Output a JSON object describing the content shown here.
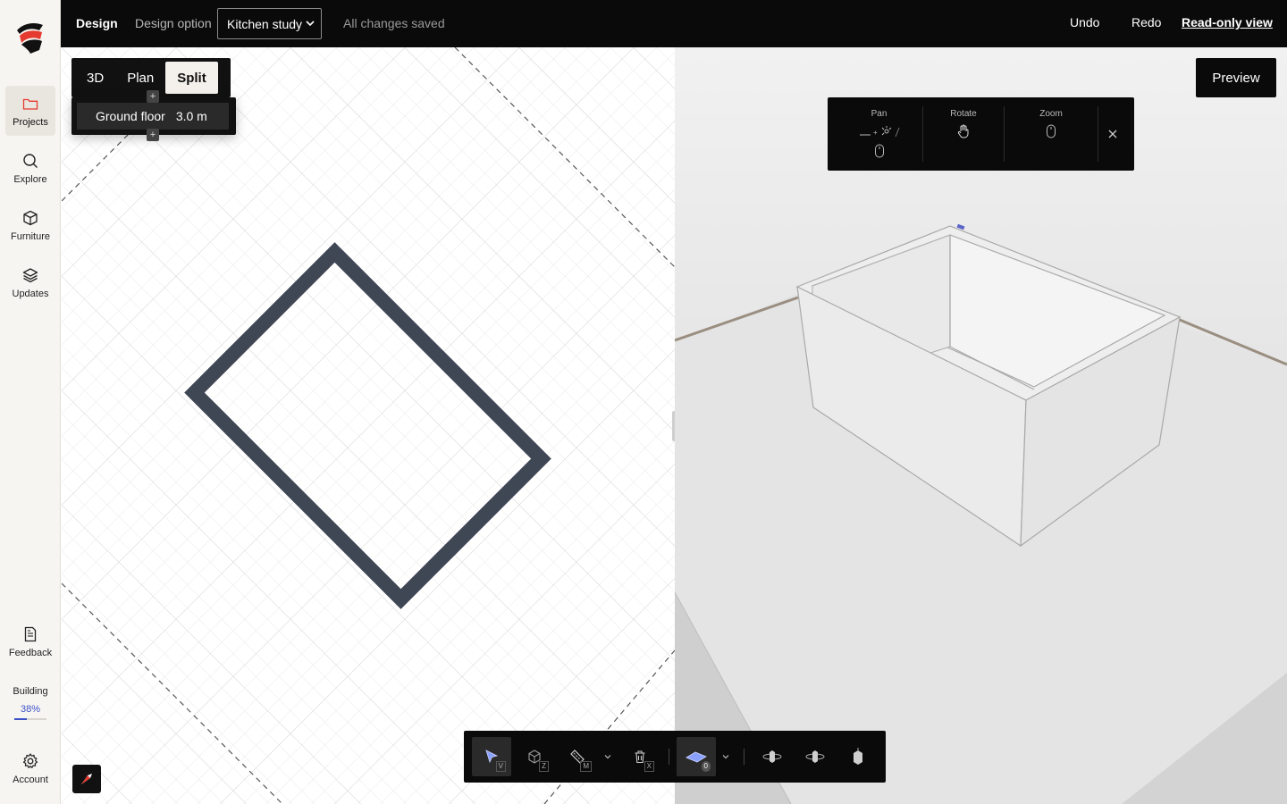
{
  "sidebar": {
    "items": [
      {
        "label": "Projects"
      },
      {
        "label": "Explore"
      },
      {
        "label": "Furniture"
      },
      {
        "label": "Updates"
      },
      {
        "label": "Feedback"
      },
      {
        "label": "Account"
      }
    ],
    "building": {
      "label": "Building",
      "percent": "38%",
      "progress": 0.38
    }
  },
  "topbar": {
    "design": "Design",
    "design_option_label": "Design option",
    "design_option_value": "Kitchen study",
    "status": "All changes saved",
    "undo": "Undo",
    "redo": "Redo",
    "readonly": "Read-only view"
  },
  "view_toggle": {
    "options": [
      "3D",
      "Plan",
      "Split"
    ],
    "active": "Split"
  },
  "floor": {
    "name": "Ground floor",
    "height": "3.0 m"
  },
  "preview": "Preview",
  "hint": {
    "pan": "Pan",
    "rotate": "Rotate",
    "zoom": "Zoom"
  },
  "toolbar": {
    "keys": {
      "select": "V",
      "object": "Z",
      "measure": "M",
      "delete": "X",
      "floor": "0"
    }
  },
  "colors": {
    "accent": "#3c50c8",
    "wall": "#3f4654",
    "dark": "#0a0a0a"
  }
}
